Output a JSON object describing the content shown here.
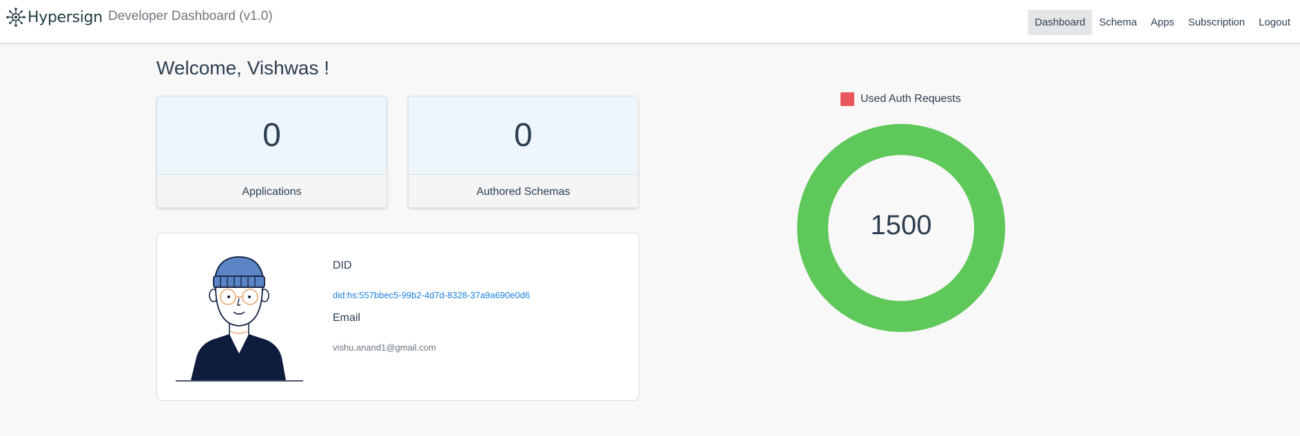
{
  "navbar": {
    "brand": "Hypersign",
    "app_title": "Developer Dashboard (v1.0)",
    "items": [
      {
        "label": "Dashboard",
        "active": true
      },
      {
        "label": "Schema",
        "active": false
      },
      {
        "label": "Apps",
        "active": false
      },
      {
        "label": "Subscription",
        "active": false
      },
      {
        "label": "Logout",
        "active": false
      }
    ]
  },
  "welcome": "Welcome, Vishwas !",
  "stats": [
    {
      "value": "0",
      "label": "Applications"
    },
    {
      "value": "0",
      "label": "Authored Schemas"
    }
  ],
  "profile": {
    "did_label": "DID",
    "did_value": "did:hs:557bbec5-99b2-4d7d-8328-37a9a690e0d6",
    "email_label": "Email",
    "email_value": "vishu.anand1@gmail.com"
  },
  "chart_data": {
    "type": "pie",
    "legend": [
      "Used Auth Requests"
    ],
    "legend_position": "top",
    "center_label": "1500",
    "series": [
      {
        "name": "Used Auth Requests",
        "value": 0,
        "color": "#e8575c"
      },
      {
        "value": 1500,
        "color": "#5fc85a"
      }
    ]
  },
  "colors": {
    "accent_green": "#5fc85a",
    "accent_red": "#e8575c",
    "link_blue": "#1a80e0"
  }
}
